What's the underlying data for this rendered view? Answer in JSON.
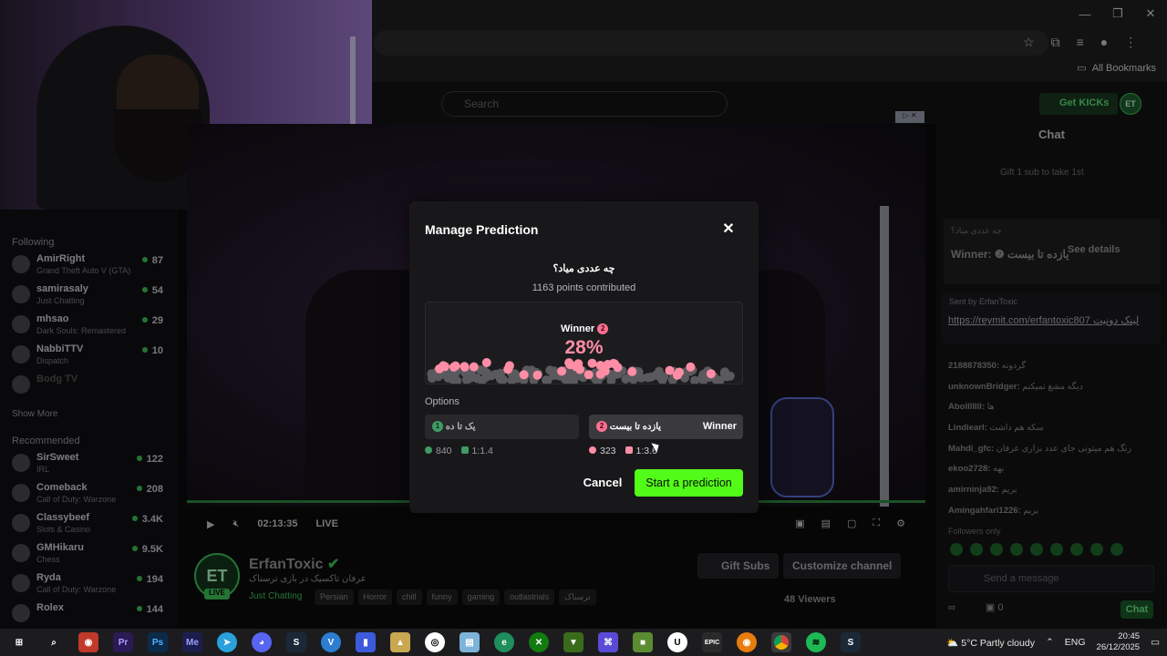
{
  "browser": {
    "bookmarks_label": "All Bookmarks",
    "window_controls": [
      "—",
      "❐",
      "✕"
    ]
  },
  "header": {
    "search_placeholder": "Search",
    "get_kicks": "Get KICKs",
    "avatar": "ET"
  },
  "sidebar": {
    "following_label": "Following",
    "following": [
      {
        "name": "AmirRight",
        "game": "Grand Theft Auto V (GTA)",
        "viewers": "87"
      },
      {
        "name": "samirasaly",
        "game": "Just Chatting",
        "viewers": "54"
      },
      {
        "name": "mhsao",
        "game": "Dark Souls: Remastered",
        "viewers": "29"
      },
      {
        "name": "NabbiTTV",
        "game": "Dispatch",
        "viewers": "10"
      }
    ],
    "offline_name": "Bodg TV",
    "show_more": "Show More",
    "recommended_label": "Recommended",
    "recommended": [
      {
        "name": "SirSweet",
        "game": "IRL",
        "viewers": "122"
      },
      {
        "name": "Comeback",
        "game": "Call of Duty: Warzone",
        "viewers": "208"
      },
      {
        "name": "Classybeef",
        "game": "Slots & Casino",
        "viewers": "3.4K"
      },
      {
        "name": "GMHikaru",
        "game": "Chess",
        "viewers": "9.5K"
      },
      {
        "name": "Ryda",
        "game": "Call of Duty: Warzone",
        "viewers": "194"
      },
      {
        "name": "Rolex",
        "game": "",
        "viewers": "144"
      }
    ]
  },
  "player": {
    "time": "02:13:35",
    "live": "LIVE"
  },
  "channel": {
    "avatar": "ET",
    "live_badge": "LIVE",
    "name": "ErfanToxic",
    "title": "عرفان تاکسیک در بازی ترسناک",
    "category": "Just Chatting",
    "tags": [
      "Persian",
      "Horror",
      "chill",
      "funny",
      "gaming",
      "outlastrials",
      "ترسناک"
    ],
    "gift_subs": "Gift Subs",
    "customize": "Customize channel",
    "viewers": "48 Viewers"
  },
  "chat": {
    "title": "Chat",
    "gift_line": "Gift 1 sub to take 1st",
    "prediction_question": "چه عددی میاد؟",
    "prediction_winner": "Winner: ❷ یازده تا بیست",
    "see_details": "See details",
    "pinned_by": "Sent by  ErfanToxic",
    "pinned_link": "https://reymit.com/erfantoxic807 لینک دونیت",
    "messages": [
      {
        "user": "2188878350:",
        "text": "گردونه"
      },
      {
        "user": "unknownBridger:",
        "text": "دیگه مشغ نمیکنم"
      },
      {
        "user": "Abolllllll:",
        "text": "ها"
      },
      {
        "user": "Lindiearl:",
        "text": "سکه هم داشت"
      },
      {
        "user": "Mahdi_gfc:",
        "text": "رنگ هم میتونی جای عدد بزاری عرفان"
      },
      {
        "user": "ekoo2728:",
        "text": "بهه"
      },
      {
        "user": "amirninja92:",
        "text": "بریم"
      },
      {
        "user": "Amingahfari1226:",
        "text": "بریم"
      }
    ],
    "followers_only": "Followers only",
    "send_placeholder": "Send a message",
    "points": "0",
    "chat_button": "Chat"
  },
  "modal": {
    "title": "Manage Prediction",
    "close": "✕",
    "question": "چه عددی میاد؟",
    "points_contributed": "1163 points contributed",
    "winner_label": "Winner",
    "winner_num": "2",
    "winner_pct": "28%",
    "options_label": "Options",
    "options": [
      {
        "num": "1",
        "label": "یک تا ده",
        "users": "840",
        "ratio": "1:1.4",
        "winner": ""
      },
      {
        "num": "2",
        "label": "یازده تا بیست",
        "users": "323",
        "ratio": "1:3.6",
        "winner": "Winner"
      }
    ],
    "cancel": "Cancel",
    "start": "Start a prediction",
    "colors": {
      "option1": "#3f9a63",
      "option2": "#ff8da5",
      "accent": "#53fc18"
    }
  },
  "taskbar": {
    "weather": "5°C  Partly cloudy",
    "lang": "ENG",
    "time": "20:45",
    "date": "26/12/2025"
  }
}
